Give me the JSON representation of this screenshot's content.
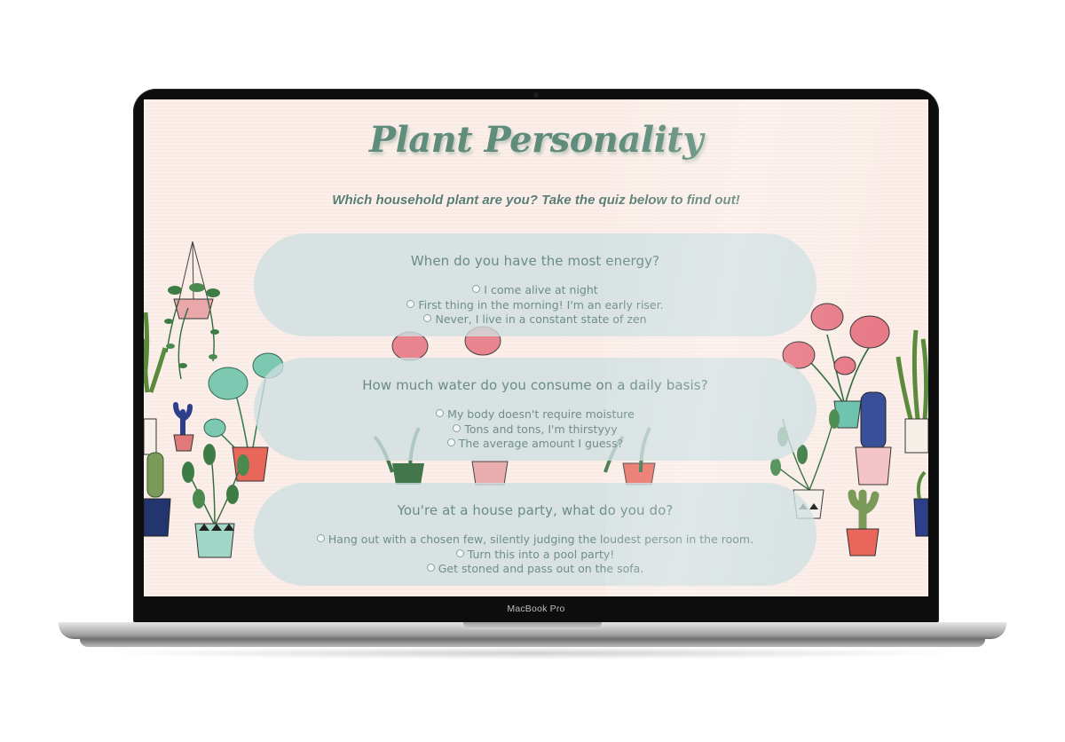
{
  "device": {
    "label": "MacBook Pro"
  },
  "page": {
    "title": "Plant Personality",
    "subtitle": "Which household plant are you? Take the quiz below to find out!"
  },
  "questions": [
    {
      "text": "When do you have the most energy?",
      "options": [
        "I come alive at night",
        "First thing in the morning! I'm an early riser.",
        "Never, I live in a constant state of zen"
      ]
    },
    {
      "text": "How much water do you consume on a daily basis?",
      "options": [
        "My body doesn't require moisture",
        "Tons and tons, I'm thirstyyy",
        "The average amount I guess?"
      ]
    },
    {
      "text": "You're at a house party, what do you do?",
      "options": [
        "Hang out with a chosen few, silently judging the loudest person in the room.",
        "Turn this into a pool party!",
        "Get stoned and pass out on the sofa."
      ]
    }
  ],
  "colors": {
    "accent": "#5f8c7b",
    "background": "#fbeee9",
    "card": "#cedfe2"
  }
}
